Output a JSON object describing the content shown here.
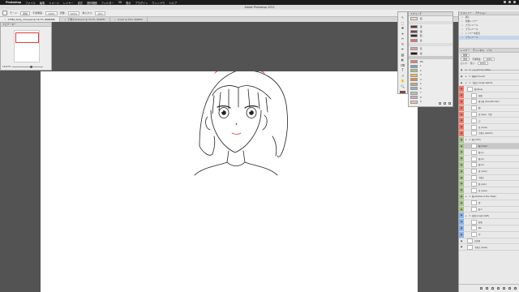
{
  "menubar": {
    "app": "Photoshop",
    "items": [
      "ファイル",
      "編集",
      "イメージ",
      "レイヤー",
      "書式",
      "選択範囲",
      "フィルター",
      "3D",
      "表示",
      "プラグイン",
      "ウィンドウ",
      "ヘルプ"
    ]
  },
  "window": {
    "title": "Adobe Photoshop 2022"
  },
  "options": {
    "mode_label": "モード:",
    "mode_value": "通常",
    "opacity_label": "不透明度:",
    "opacity_value": "100%",
    "flow_label": "流量:",
    "flow_value": "100%",
    "smoothing_label": "滑らかさ:",
    "smoothing_value": "10%"
  },
  "tabs": [
    {
      "label": "1758e_body_color.psd @ 16.7% (RGB/8#)",
      "active": true
    },
    {
      "label": "下書きillust.psd @ 33.3% (RGB/8)",
      "active": false
    },
    {
      "label": "ill.psd @ 50% (RGB/8)",
      "active": false
    }
  ],
  "navigator": {
    "title": "ナビゲーター",
    "zoom": "16.67%"
  },
  "toolbar": {
    "tools": [
      "↖",
      "⬚",
      "✥",
      "⌖",
      "✂",
      "✎",
      "✒",
      "▨",
      "◐",
      "⌫",
      "T",
      "↗",
      "✋",
      "🔍"
    ],
    "foreground_color": "#e3211c"
  },
  "swatches": {
    "title": "スウォッチ",
    "items": [
      {
        "name": "肌",
        "color": "#f5dcc8",
        "group": false,
        "selected": false
      },
      {
        "name": "",
        "color": "",
        "group": true,
        "selected": false
      },
      {
        "name": "髪",
        "color": "#5a3a2e",
        "group": false,
        "selected": false
      },
      {
        "name": "瞳",
        "color": "#6d4a3f",
        "group": false,
        "selected": false
      },
      {
        "name": "服",
        "color": "#2c2c2c",
        "group": false,
        "selected": false
      },
      {
        "name": "唇",
        "color": "#e96c6c",
        "group": false,
        "selected": false
      },
      {
        "name": "",
        "color": "",
        "group": true,
        "selected": false
      },
      {
        "name": "影",
        "color": "#d9a59a",
        "group": false,
        "selected": false
      },
      {
        "name": "線",
        "color": "#1a1a1a",
        "group": false,
        "selected": false
      },
      {
        "name": "",
        "color": "",
        "group": true,
        "selected": true
      },
      {
        "name": "BG",
        "color": "#f07a6a",
        "group": false,
        "selected": false
      },
      {
        "name": "1",
        "color": "#7fa0c8",
        "group": false,
        "selected": false
      },
      {
        "name": "2",
        "color": "#a6c48a",
        "group": false,
        "selected": false
      },
      {
        "name": "3",
        "color": "#f0b85a",
        "group": false,
        "selected": false
      },
      {
        "name": "4",
        "color": "#e58a3a",
        "group": false,
        "selected": false
      },
      {
        "name": "5",
        "color": "#c8a07a",
        "group": false,
        "selected": false
      },
      {
        "name": "6",
        "color": "#8ab4d2",
        "group": false,
        "selected": false
      },
      {
        "name": "7",
        "color": "#b7c7a3",
        "group": false,
        "selected": false
      },
      {
        "name": "8",
        "color": "#d3a6b8",
        "group": false,
        "selected": false
      },
      {
        "name": "9",
        "color": "#efc9a0",
        "group": false,
        "selected": false
      }
    ]
  },
  "right_panel": {
    "history_tabs": [
      "ヒストリー",
      "アクション"
    ],
    "history": [
      {
        "label": "開く",
        "selected": false
      },
      {
        "label": "新規レイヤー",
        "selected": false
      },
      {
        "label": "ブラシツール",
        "selected": false
      },
      {
        "label": "ブラシツール",
        "selected": false
      },
      {
        "label": "レイヤーを結合",
        "selected": false
      },
      {
        "label": "ブラシツール",
        "selected": true
      }
    ],
    "layers_tabs": [
      "レイヤー",
      "チャンネル",
      "パス"
    ],
    "kind_label": "種類",
    "blend_mode": "通常",
    "opacity_label": "不透明度:",
    "opacity_value": "100%",
    "lock_label": "ロック:",
    "fill_label": "塗り:",
    "fill_value": "100%"
  },
  "layers": [
    {
      "name": "メモ (for my notes)",
      "color": "#e9e9e9",
      "indent": 0,
      "fold": true,
      "selected": false,
      "thumb": false
    },
    {
      "name": "線画 (line art)",
      "color": "#e9e9e9",
      "indent": 0,
      "fold": true,
      "selected": false,
      "thumb": false
    },
    {
      "name": "下描き (rough sketch)",
      "color": "#e9e9e9",
      "indent": 0,
      "fold": true,
      "selected": false,
      "thumb": false
    },
    {
      "name": "顔 (face)",
      "color": "#f07a6a",
      "indent": 0,
      "fold": false,
      "selected": false,
      "thumb": true
    },
    {
      "name": "前髪",
      "color": "#f07a6a",
      "indent": 1,
      "fold": false,
      "selected": false,
      "thumb": true
    },
    {
      "name": "後ろ髪 (shoulder-hair)",
      "color": "#f07a6a",
      "indent": 1,
      "fold": false,
      "selected": false,
      "thumb": true
    },
    {
      "name": "顔",
      "color": "#f07a6a",
      "indent": 1,
      "fold": false,
      "selected": false,
      "thumb": true
    },
    {
      "name": "目 (eye) - 下絵",
      "color": "#f07a6a",
      "indent": 1,
      "fold": false,
      "selected": false,
      "thumb": true
    },
    {
      "name": "口",
      "color": "#f07a6a",
      "indent": 1,
      "fold": false,
      "selected": false,
      "thumb": true
    },
    {
      "name": "目 (inner)",
      "color": "#f07a6a",
      "indent": 1,
      "fold": false,
      "selected": false,
      "thumb": true
    },
    {
      "name": "下書き (sketch)",
      "color": "#f07a6a",
      "indent": 1,
      "fold": false,
      "selected": false,
      "thumb": true
    },
    {
      "name": "服 (cloth)",
      "color": "#a6c48a",
      "indent": 0,
      "fold": true,
      "selected": false,
      "thumb": false
    },
    {
      "name": "服 (main)",
      "color": "#a6c48a",
      "indent": 1,
      "fold": false,
      "selected": true,
      "thumb": true
    },
    {
      "name": "服 (1)",
      "color": "#a6c48a",
      "indent": 1,
      "fold": false,
      "selected": false,
      "thumb": true
    },
    {
      "name": "服 (2)",
      "color": "#a6c48a",
      "indent": 1,
      "fold": false,
      "selected": false,
      "thumb": true
    },
    {
      "name": "服 (3)",
      "color": "#a6c48a",
      "indent": 1,
      "fold": false,
      "selected": false,
      "thumb": true
    },
    {
      "name": "首 (neck)",
      "color": "#a6c48a",
      "indent": 1,
      "fold": false,
      "selected": false,
      "thumb": true
    },
    {
      "name": "下塗り",
      "color": "#a6c48a",
      "indent": 1,
      "fold": false,
      "selected": false,
      "thumb": true
    },
    {
      "name": "肌 (skin)",
      "color": "#a6c48a",
      "indent": 1,
      "fold": false,
      "selected": false,
      "thumb": true
    },
    {
      "name": "目 (eyes)",
      "color": "#a6c48a",
      "indent": 1,
      "fold": false,
      "selected": false,
      "thumb": true
    },
    {
      "name": "瞳 (shadow of the cheek)",
      "color": "#a6c48a",
      "indent": 0,
      "fold": true,
      "selected": false,
      "thumb": false
    },
    {
      "name": "影",
      "color": "#a6c48a",
      "indent": 1,
      "fold": false,
      "selected": false,
      "thumb": true
    },
    {
      "name": "影 2",
      "color": "#a6c48a",
      "indent": 1,
      "fold": false,
      "selected": false,
      "thumb": true
    },
    {
      "name": "背景 (rough draft)",
      "color": "#8ab4e8",
      "indent": 0,
      "fold": true,
      "selected": false,
      "thumb": false
    },
    {
      "name": "背景",
      "color": "#8ab4e8",
      "indent": 1,
      "fold": false,
      "selected": false,
      "thumb": true
    },
    {
      "name": "BG",
      "color": "#8ab4e8",
      "indent": 1,
      "fold": false,
      "selected": false,
      "thumb": true
    },
    {
      "name": "空",
      "color": "#8ab4e8",
      "indent": 1,
      "fold": false,
      "selected": false,
      "thumb": true
    },
    {
      "name": "白背景",
      "color": "#e9e9e9",
      "indent": 0,
      "fold": false,
      "selected": false,
      "thumb": true
    },
    {
      "name": "下書き (mass)",
      "color": "#e9e9e9",
      "indent": 0,
      "fold": false,
      "selected": false,
      "thumb": true
    }
  ]
}
